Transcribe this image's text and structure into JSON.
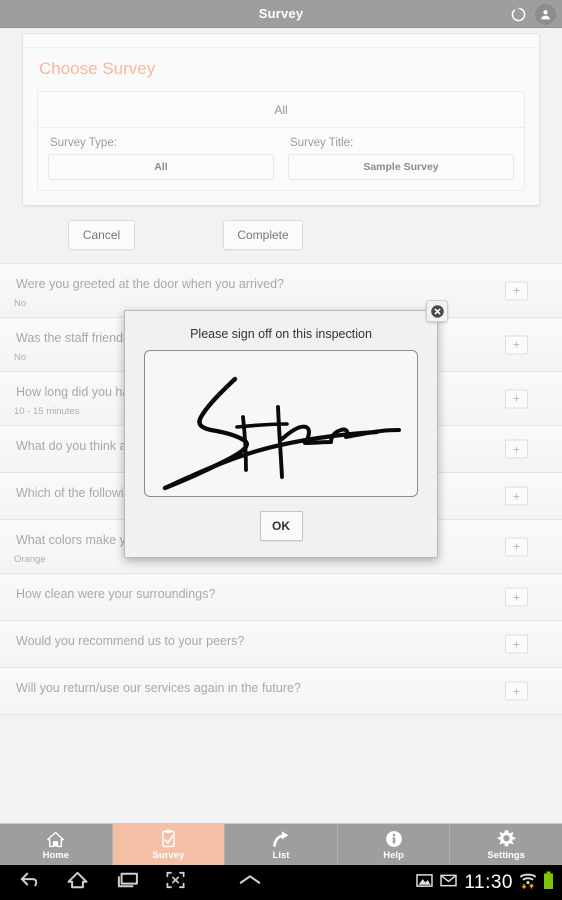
{
  "titlebar": {
    "title": "Survey",
    "refresh_icon": "refresh-icon",
    "account_icon": "person-icon"
  },
  "choose_survey": {
    "heading": "Choose Survey",
    "picker_value": "All",
    "fields": [
      {
        "label": "Survey Type:",
        "value": "All"
      },
      {
        "label": "Survey Title:",
        "value": "Sample Survey"
      }
    ]
  },
  "actions": {
    "cancel_label": "Cancel",
    "complete_label": "Complete"
  },
  "questions": [
    {
      "text": "Were you greeted at the door when you arrived?",
      "answer": "No",
      "add_label": "+"
    },
    {
      "text": "Was the staff friendly?",
      "answer": "No",
      "add_label": "+"
    },
    {
      "text": "How long did you have to wait?",
      "answer": "10 - 15 minutes",
      "add_label": "+"
    },
    {
      "text": "What do you think about our services?",
      "answer": "",
      "add_label": "+"
    },
    {
      "text": "Which of the following applies?",
      "answer": "",
      "add_label": "+"
    },
    {
      "text": "What colors make you feel at ease?",
      "answer": "Orange",
      "add_label": "+"
    },
    {
      "text": "How clean were your surroundings?",
      "answer": "",
      "add_label": "+"
    },
    {
      "text": "Would you recommend us to your peers?",
      "answer": "",
      "add_label": "+"
    },
    {
      "text": "Will you return/use our services again in the future?",
      "answer": "",
      "add_label": "+"
    }
  ],
  "dialog": {
    "title": "Please sign off on this inspection",
    "ok_label": "OK",
    "close_icon": "close-icon",
    "signature_alt": "handwritten-signature"
  },
  "tabs": [
    {
      "label": "Home",
      "icon": "home-icon",
      "active": false
    },
    {
      "label": "Survey",
      "icon": "clipboard-check-icon",
      "active": true
    },
    {
      "label": "List",
      "icon": "share-arrow-icon",
      "active": false
    },
    {
      "label": "Help",
      "icon": "info-icon",
      "active": false
    },
    {
      "label": "Settings",
      "icon": "gear-icon",
      "active": false
    }
  ],
  "systembar": {
    "back_icon": "back-icon",
    "home_icon": "home-outline-icon",
    "recents_icon": "recent-apps-icon",
    "screenshot_icon": "screen-capture-icon",
    "expand_icon": "chevron-up-icon",
    "image_icon": "image-icon",
    "mail_icon": "mail-icon",
    "clock": "11:30",
    "wifi_icon": "wifi-icon",
    "battery_icon": "battery-full-icon"
  },
  "colors": {
    "accent": "#f5bfa6",
    "heading": "#f5b89e",
    "titlebar": "#9e9e9e",
    "battery": "#7ec400"
  }
}
